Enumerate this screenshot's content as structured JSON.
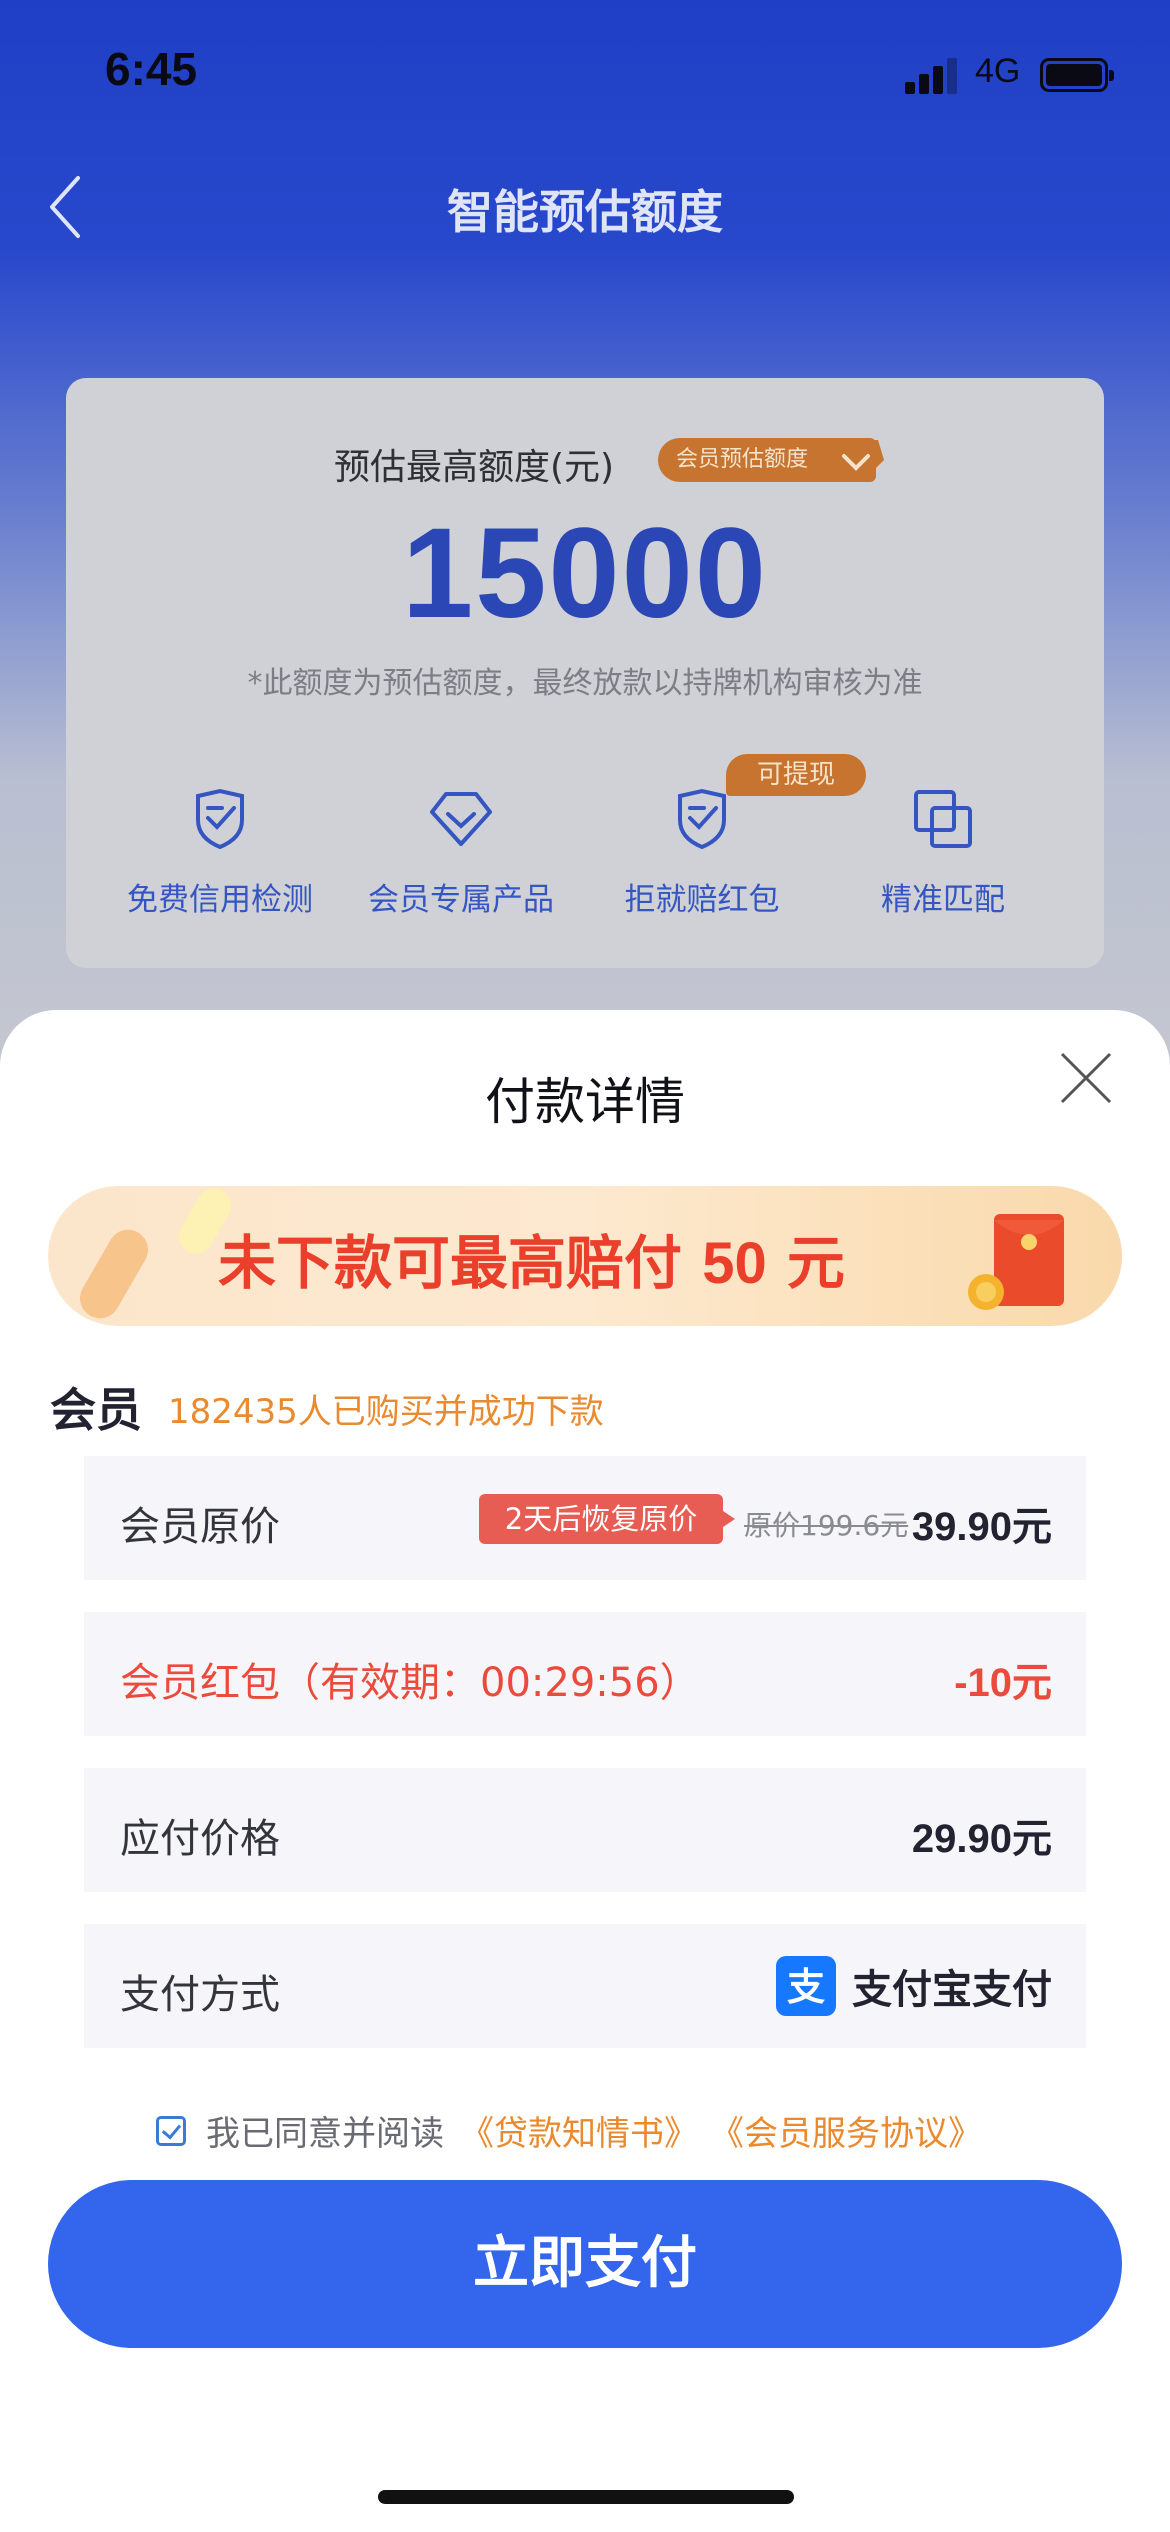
{
  "status_bar": {
    "time": "6:45",
    "network": "4G"
  },
  "nav": {
    "title": "智能预估额度"
  },
  "estimate": {
    "label": "预估最高额度(元)",
    "member_tag": "会员预估额度",
    "amount": "15000",
    "note": "*此额度为预估额度，最终放款以持牌机构审核为准",
    "features": [
      {
        "label": "免费信用检测",
        "icon": "shield-check-icon"
      },
      {
        "label": "会员专属产品",
        "icon": "diamond-icon"
      },
      {
        "label": "拒就赔红包",
        "icon": "shield-check-icon",
        "badge": "可提现"
      },
      {
        "label": "精准匹配",
        "icon": "overlap-squares-icon"
      }
    ]
  },
  "sheet": {
    "title": "付款详情",
    "banner": {
      "prefix": "未下款可最高赔付 ",
      "amount": "50",
      "suffix": " 元"
    },
    "member": {
      "label": "会员",
      "buyers": "182435人已购买并成功下款"
    },
    "rows": {
      "original": {
        "label": "会员原价",
        "badge": "2天后恢复原价",
        "strike": "原价199.6元",
        "value": "39.90元"
      },
      "redpacket": {
        "label": "会员红包（有效期：00:29:56）",
        "value": "-10元"
      },
      "payable": {
        "label": "应付价格",
        "value": "29.90元"
      },
      "method": {
        "label": "支付方式",
        "value": "支付宝支付"
      }
    },
    "agreement": {
      "text": "我已同意并阅读",
      "links": [
        "《贷款知情书》",
        "《会员服务协议》"
      ],
      "checked": true
    },
    "pay_button": "立即支付"
  },
  "colors": {
    "primary": "#3366ec",
    "accent_orange": "#ea8a2f",
    "red": "#ea4b3c",
    "alipay": "#1677ff"
  }
}
